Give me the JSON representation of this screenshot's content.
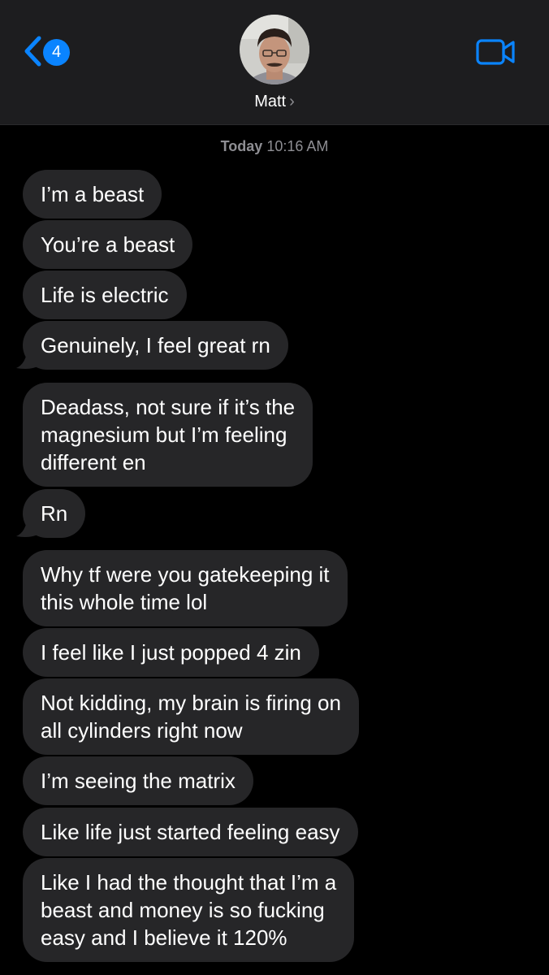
{
  "header": {
    "back_badge_count": "4",
    "contact_name": "Matt",
    "contact_chevron": "›",
    "icons": {
      "back": "chevron-left-icon",
      "video": "video-camera-icon"
    },
    "accent_color": "#0a84ff"
  },
  "thread": {
    "timestamp_day": "Today",
    "timestamp_time": "10:16 AM",
    "bubble_color": "#262628",
    "messages": [
      "I’m a beast",
      "You’re a beast",
      "Life is electric",
      "Genuinely, I feel great rn",
      "Deadass, not sure if it’s the\nmagnesium but I’m feeling\ndifferent en",
      "Rn",
      "Why tf were you gatekeeping it\nthis whole time lol",
      "I feel like I just popped 4 zin",
      "Not kidding, my brain is firing on\nall cylinders right now",
      "I’m seeing the matrix",
      "Like life just started feeling easy",
      "Like I had the thought that I’m a\nbeast and money is so fucking\neasy and I believe it 120%"
    ]
  }
}
